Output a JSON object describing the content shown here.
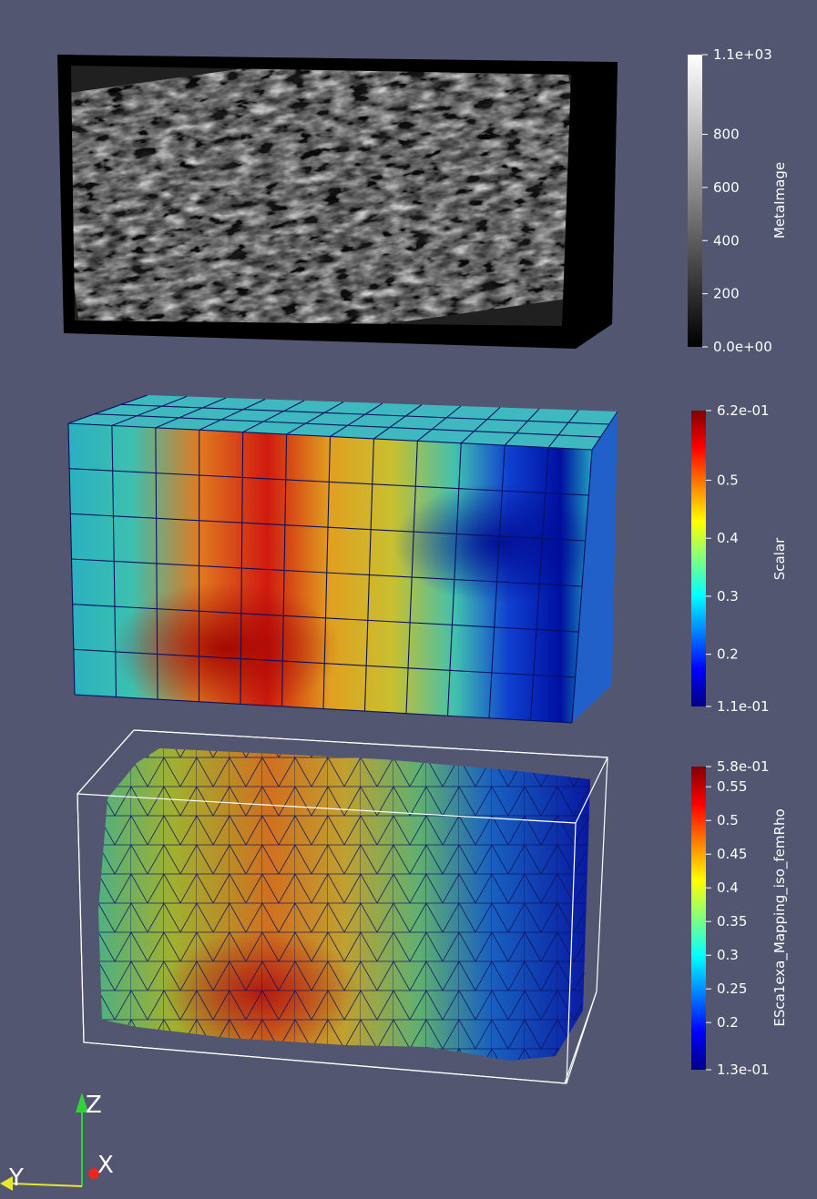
{
  "colors": {
    "background": "#525670",
    "axis_x": "#e8281e",
    "axis_y": "#e6e630",
    "axis_z": "#35d13a"
  },
  "colorbars": [
    {
      "title": "MetaImage",
      "colormap": "grayscale",
      "range": [
        0,
        1100
      ],
      "ticks": [
        {
          "value": 1100,
          "label": "1.1e+03"
        },
        {
          "value": 800,
          "label": "800"
        },
        {
          "value": 600,
          "label": "600"
        },
        {
          "value": 400,
          "label": "400"
        },
        {
          "value": 200,
          "label": "200"
        },
        {
          "value": 0,
          "label": "0.0e+00"
        }
      ]
    },
    {
      "title": "Scalar",
      "colormap": "jet",
      "range": [
        0.11,
        0.62
      ],
      "ticks": [
        {
          "value": 0.62,
          "label": "6.2e-01"
        },
        {
          "value": 0.5,
          "label": "0.5"
        },
        {
          "value": 0.4,
          "label": "0.4"
        },
        {
          "value": 0.3,
          "label": "0.3"
        },
        {
          "value": 0.2,
          "label": "0.2"
        },
        {
          "value": 0.11,
          "label": "1.1e-01"
        }
      ]
    },
    {
      "title": "ESca1exa_Mapping_iso_femRho",
      "colormap": "jet",
      "range": [
        0.13,
        0.58
      ],
      "ticks": [
        {
          "value": 0.58,
          "label": "5.8e-01"
        },
        {
          "value": 0.55,
          "label": "0.55"
        },
        {
          "value": 0.5,
          "label": "0.5"
        },
        {
          "value": 0.45,
          "label": "0.45"
        },
        {
          "value": 0.4,
          "label": "0.4"
        },
        {
          "value": 0.35,
          "label": "0.35"
        },
        {
          "value": 0.3,
          "label": "0.3"
        },
        {
          "value": 0.25,
          "label": "0.25"
        },
        {
          "value": 0.2,
          "label": "0.2"
        },
        {
          "value": 0.13,
          "label": "1.3e-01"
        }
      ]
    }
  ],
  "orientation_axes": {
    "x_label": "X",
    "y_label": "Y",
    "z_label": "Z"
  }
}
